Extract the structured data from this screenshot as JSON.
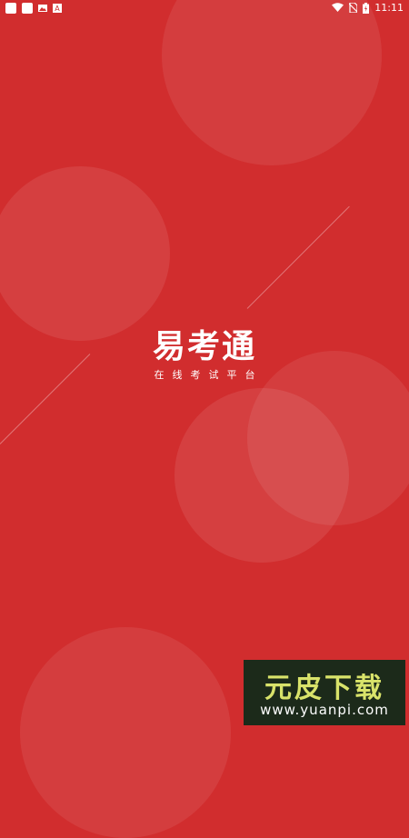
{
  "status_bar": {
    "left_icons": [
      "square-icon",
      "square-icon",
      "image-icon",
      "a-icon"
    ],
    "right_icons": [
      "wifi-icon",
      "no-sim-icon",
      "battery-icon"
    ],
    "time": "11:11"
  },
  "splash": {
    "app_name": "易考通",
    "tagline": "在线考试平台"
  },
  "watermark": {
    "title": "元皮下载",
    "url": "www.yuanpi.com"
  },
  "colors": {
    "background": "#d12d2e",
    "watermark_bg": "#1c2a1a",
    "watermark_title": "#d9e36a"
  }
}
